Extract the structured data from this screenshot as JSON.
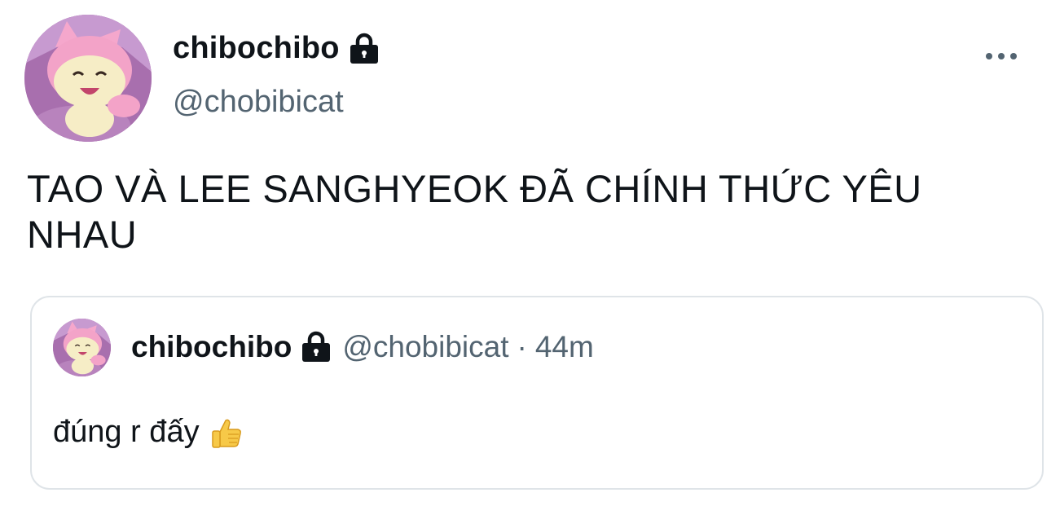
{
  "tweet": {
    "author": {
      "display_name": "chibochibo",
      "handle": "@chobibicat",
      "protected_icon": "lock-icon",
      "avatar": "skitty-avatar"
    },
    "more_icon": "more-dots-icon",
    "text": "TAO VÀ LEE SANGHYEOK ĐÃ CHÍNH THỨC YÊU NHAU"
  },
  "quote": {
    "author": {
      "display_name": "chibochibo",
      "handle": "@chobibicat",
      "protected_icon": "lock-icon",
      "avatar": "skitty-avatar"
    },
    "separator": "·",
    "time": "44m",
    "text": "đúng r đấy",
    "emoji_icon": "thumbs-up-icon"
  },
  "colors": {
    "text_primary": "#0f1419",
    "text_secondary": "#536471",
    "card_border": "#dfe4e8"
  }
}
